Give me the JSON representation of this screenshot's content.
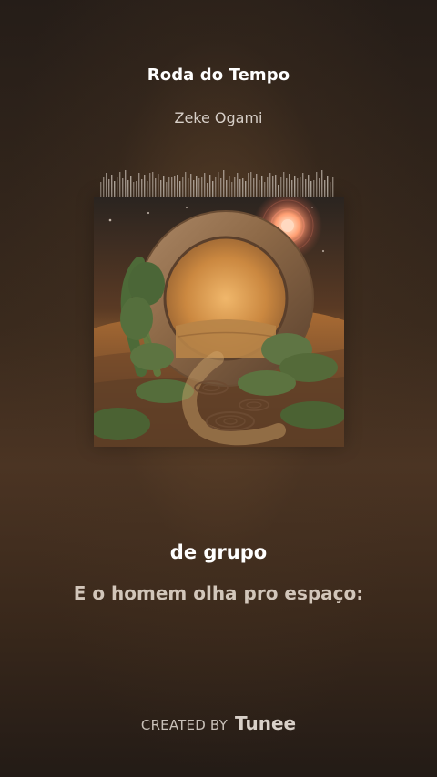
{
  "song": {
    "title": "Roda do Tempo",
    "artist": "Zeke Ogami"
  },
  "lyrics": {
    "current": "de grupo",
    "next": "E o homem olha pro espaço:"
  },
  "footer": {
    "created_by": "CREATED BY",
    "brand": "Tunee"
  },
  "colors": {
    "background_dark": "#251d18",
    "background_warm": "#4b3423",
    "accent_light": "#ffffff"
  }
}
